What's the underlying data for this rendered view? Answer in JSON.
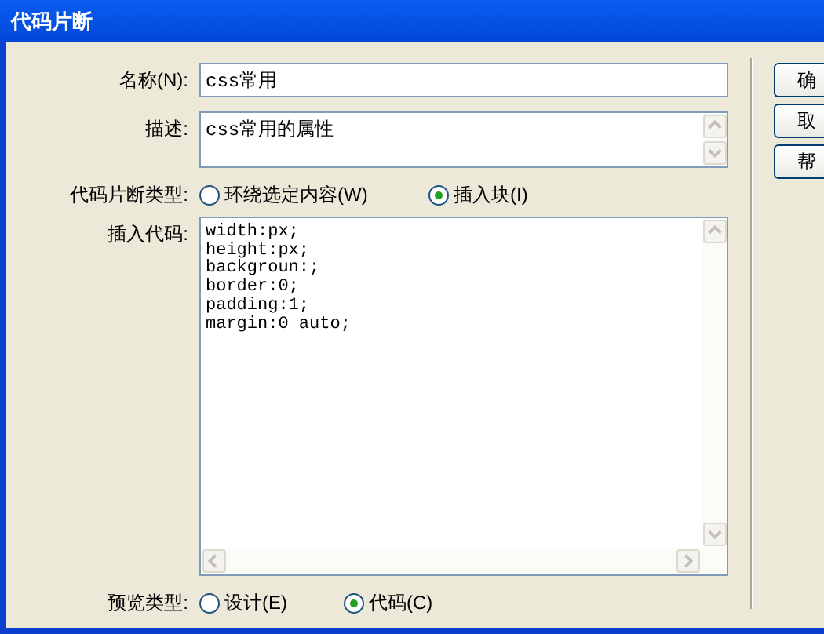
{
  "window": {
    "title": "代码片断"
  },
  "fields": [
    {
      "kind": "text",
      "label": "名称(N):",
      "value": "css常用"
    },
    {
      "kind": "textarea",
      "label": "描述:",
      "value": "css常用的属性"
    }
  ],
  "snippet_type": {
    "label": "代码片断类型:",
    "options": [
      {
        "label": "环绕选定内容(W)",
        "selected": false
      },
      {
        "label": "插入块(I)",
        "selected": true
      }
    ]
  },
  "code": {
    "label": "插入代码:",
    "lines": [
      "width:px;",
      "height:px;",
      "backgroun:;",
      "border:0;",
      "padding:1;",
      "margin:0 auto;"
    ]
  },
  "preview_type": {
    "label": "预览类型:",
    "options": [
      {
        "label": "设计(E)",
        "selected": false
      },
      {
        "label": "代码(C)",
        "selected": true
      }
    ]
  },
  "buttons": [
    "确",
    "取",
    "帮"
  ]
}
